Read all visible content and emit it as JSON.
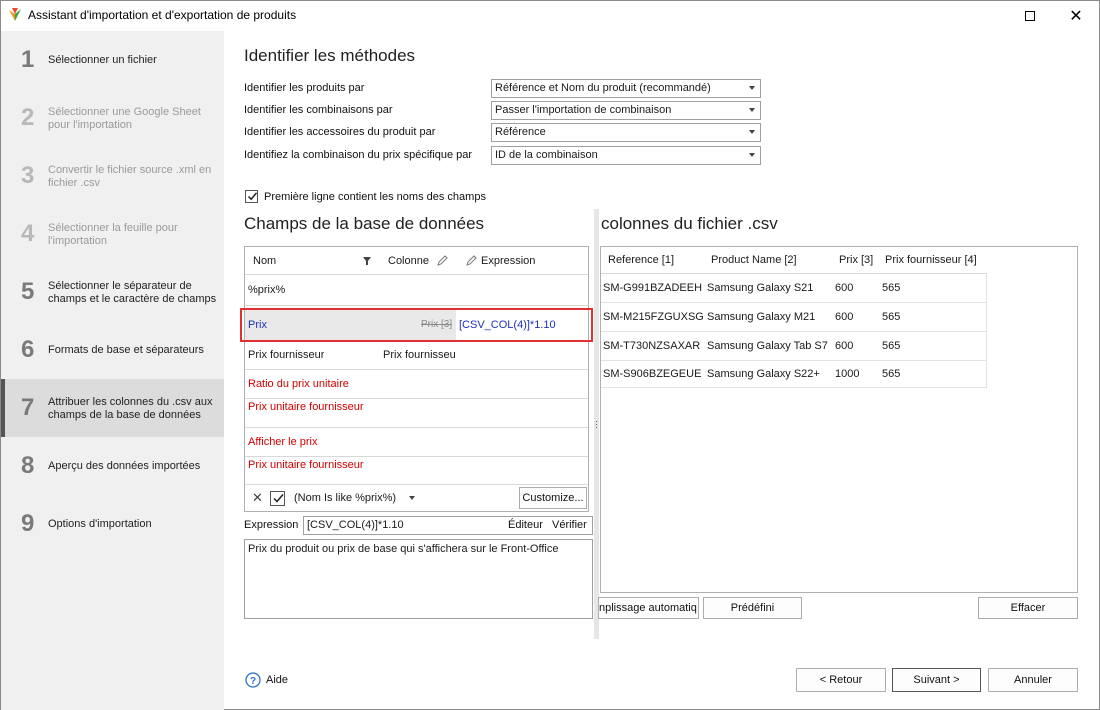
{
  "window": {
    "title": "Assistant d'importation et d'exportation de produits"
  },
  "sidebar": {
    "steps": [
      {
        "num": "1",
        "label": "Sélectionner un fichier"
      },
      {
        "num": "2",
        "label": "Sélectionner une Google Sheet pour l'importation"
      },
      {
        "num": "3",
        "label": "Convertir le fichier source .xml en fichier .csv"
      },
      {
        "num": "4",
        "label": "Sélectionner la feuille pour l'importation"
      },
      {
        "num": "5",
        "label": "Sélectionner le séparateur de champs et le caractère de champs"
      },
      {
        "num": "6",
        "label": "Formats de base et séparateurs"
      },
      {
        "num": "7",
        "label": "Attribuer les colonnes du .csv aux champs de la base de données"
      },
      {
        "num": "8",
        "label": "Aperçu des données importées"
      },
      {
        "num": "9",
        "label": "Options d'importation"
      }
    ]
  },
  "methods": {
    "title": "Identifier les méthodes",
    "rows": [
      {
        "label": "Identifier les produits par",
        "value": "Référence et Nom du produit (recommandé)"
      },
      {
        "label": "Identifier les combinaisons par",
        "value": "Passer l'importation de combinaison"
      },
      {
        "label": "Identifier les accessoires du produit par",
        "value": "Référence"
      },
      {
        "label": "Identifiez la combinaison du prix spécifique par",
        "value": "ID de la combinaison"
      }
    ],
    "first_line_checkbox": "Première ligne contient les noms des champs"
  },
  "db_fields": {
    "title": "Champs de la base de données",
    "col_name": "Nom",
    "col_column": "Colonne",
    "col_expression": "Expression",
    "filter_value": "%prix%",
    "rows": [
      {
        "name": "Prix",
        "column": "Prix [3]",
        "expression": "[CSV_COL(4)]*1.10"
      },
      {
        "name": "Prix fournisseur",
        "column": "Prix fournisseur",
        "expression": ""
      },
      {
        "name": "Ratio du prix unitaire",
        "column": "",
        "expression": ""
      },
      {
        "name": "Prix unitaire fournisseur",
        "column": "",
        "expression": ""
      },
      {
        "name": "Afficher le prix",
        "column": "",
        "expression": ""
      },
      {
        "name": "Prix unitaire fournisseur",
        "column": "",
        "expression": ""
      }
    ],
    "filter_text": "(Nom Is like %prix%)",
    "customize_label": "Customize...",
    "expression_label": "Expression",
    "expression_value": "[CSV_COL(4)]*1.10",
    "editor_label": "Éditeur",
    "verify_label": "Vérifier",
    "description": "Prix du produit ou prix de base qui s'affichera sur le Front-Office"
  },
  "csv_columns": {
    "title": "colonnes du fichier .csv",
    "headers": [
      "Reference [1]",
      "Product Name [2]",
      "Prix [3]",
      "Prix fournisseur [4]"
    ],
    "rows": [
      [
        "SM-G991BZADEEH",
        "Samsung Galaxy S21",
        "600",
        "565"
      ],
      [
        "SM-M215FZGUXSG",
        "Samsung Galaxy M21",
        "600",
        "565"
      ],
      [
        "SM-T730NZSAXAR",
        "Samsung Galaxy Tab S7",
        "600",
        "565"
      ],
      [
        "SM-S906BZEGEUE",
        "Samsung Galaxy S22+",
        "1000",
        "565"
      ]
    ],
    "autofill_label": "nplissage automatiq",
    "predefined_label": "Prédéfini",
    "clear_label": "Effacer"
  },
  "footer": {
    "help_label": "Aide",
    "back_label": "< Retour",
    "next_label": "Suivant >",
    "cancel_label": "Annuler"
  },
  "colors": {
    "required_field": "#d00000",
    "mapped_field": "#1d2fbf",
    "highlight_border": "#e03030"
  }
}
